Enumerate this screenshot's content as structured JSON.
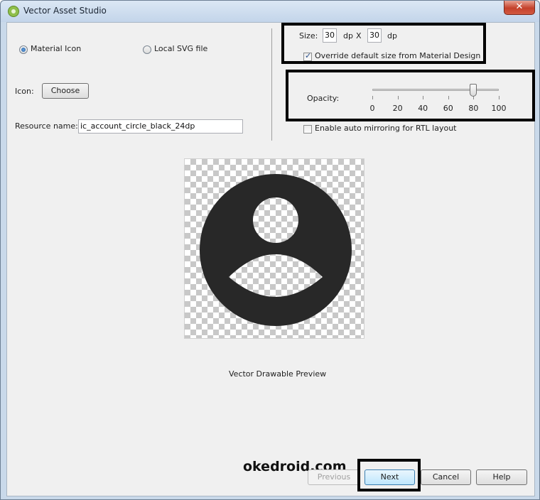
{
  "window": {
    "title": "Vector Asset Studio",
    "close_glyph": "✕"
  },
  "source": {
    "material_icon_label": "Material Icon",
    "material_icon_selected": true,
    "local_svg_label": "Local SVG file",
    "local_svg_selected": false
  },
  "icon": {
    "label": "Icon:",
    "choose_label": "Choose"
  },
  "resource": {
    "label": "Resource name:",
    "value": "ic_account_circle_black_24dp"
  },
  "size": {
    "label": "Size:",
    "width": "30",
    "unit_1": "dp",
    "separator": "X",
    "height": "30",
    "unit_2": "dp",
    "override_label": "Override default size from Material Design",
    "override_checked": true
  },
  "opacity": {
    "label": "Opacity:",
    "value": 80,
    "min": 0,
    "max": 100,
    "ticks": [
      "0",
      "20",
      "40",
      "60",
      "80",
      "100"
    ]
  },
  "rtl": {
    "label": "Enable auto mirroring for RTL layout",
    "checked": false
  },
  "preview": {
    "caption": "Vector Drawable Preview",
    "icon": "account-circle-icon",
    "icon_color": "#282828"
  },
  "watermark": "okedroid.com",
  "footer": {
    "previous_label": "Previous",
    "next_label": "Next",
    "cancel_label": "Cancel",
    "help_label": "Help"
  }
}
